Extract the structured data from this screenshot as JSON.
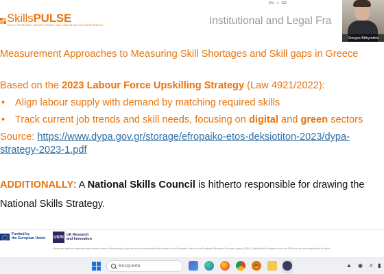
{
  "slide": {
    "logo": {
      "main_skills": "Skills",
      "main_pulse": "PULSE",
      "tagline": "SKILLS, PROBLEMS, UNEMPLOYMENT, AND LABOUR EDUCATION/RESEARCH"
    },
    "title": "Institutional and Legal Fra",
    "language_indicators": [
      "EN",
      "••",
      "GR"
    ],
    "heading": "Measurement Approaches to Measuring Skill Shortages and Skill gaps in Greece",
    "paragraph1": {
      "prefix": "Based on the ",
      "bold": "2023 Labour Force Upskilling Strategy",
      "suffix": " (Law 4921/2022):"
    },
    "bullets": [
      {
        "symbol": "•",
        "text": "Align labour supply with demand by matching required skills"
      },
      {
        "symbol": "•",
        "prefix": "Track current job trends and skill needs, focusing on ",
        "bold1": "digital",
        "mid": " and ",
        "bold2": "green",
        "suffix": " sectors"
      }
    ],
    "source": {
      "label": "Source: ",
      "link_line1": "https://www.dypa.gov.gr/storage/efropaiko-etos-deksiotiton-2023/dypa-",
      "link_line2": "strategy-2023-1.pdf"
    },
    "additionally": {
      "highlight": "ADDITIONALLY",
      "colon": ": A ",
      "bold": "National Skills Council",
      "rest": " is hitherto responsible for drawing the",
      "line2": "National Skills Strategy."
    },
    "footer": {
      "eu_line1": "Funded by",
      "eu_line2": "the European Union",
      "ukri_logo": "UKRI",
      "ukri_line1": "UK Research",
      "ukri_line2": "and Innovation",
      "disclaimer": "Views and opinions expressed are however those of the author(s) only and do not necessarily reflect those of the European Union or the European Research Executive Agency (REA). Neither the European Union nor REA can be held responsible for them."
    }
  },
  "video": {
    "participant_name": "Giorgos Bithymitris"
  },
  "taskbar": {
    "search_placeholder": "Búsqueda",
    "colors": {
      "start": "#1f6fd6",
      "accent": "#e8730c",
      "link": "#2f6ea6"
    },
    "icons": [
      "start-icon",
      "search-icon",
      "task-view-icon",
      "edge-icon",
      "firefox-icon",
      "chrome-icon",
      "chrome-profile-icon",
      "file-explorer-icon",
      "teams-icon",
      "media-player-icon"
    ]
  }
}
